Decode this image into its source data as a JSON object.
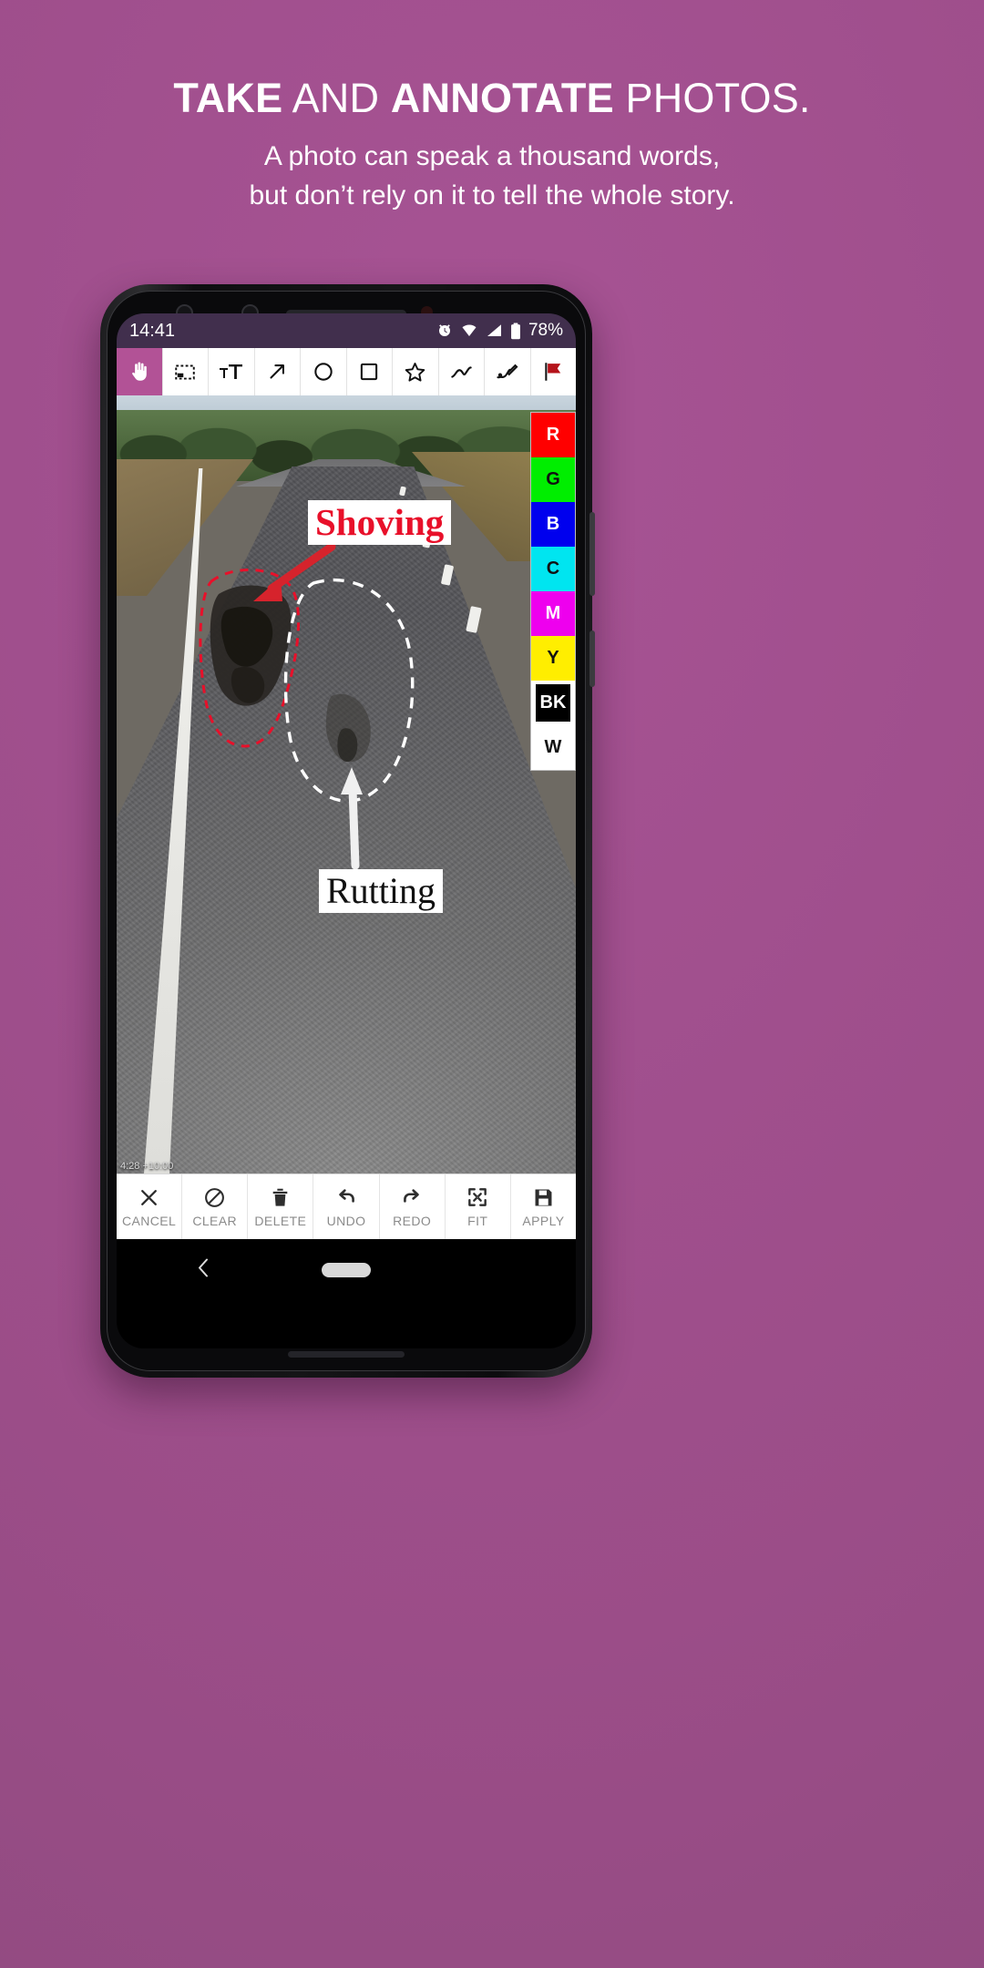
{
  "promo": {
    "headline_part1": "TAKE",
    "headline_part2": " AND ",
    "headline_part3": "ANNOTATE",
    "headline_part4": " PHOTOS.",
    "subtitle_line1": "A photo can speak a thousand words,",
    "subtitle_line2": "but don’t rely on it to tell the whole story.",
    "background_color": "#a04f8d",
    "text_color": "#ffffff"
  },
  "phone": {
    "statusbar": {
      "time": "14:41",
      "battery_percent": "78%",
      "icons": [
        "alarm-icon",
        "wifi-icon",
        "signal-icon",
        "battery-icon"
      ],
      "background_color": "#412f4d"
    },
    "navbar": {
      "back_label": "back-button",
      "home_pill": "home-pill"
    }
  },
  "toolbar": {
    "active_index": 0,
    "tools": [
      {
        "name": "pan-tool",
        "label": "Pan"
      },
      {
        "name": "crop-tool",
        "label": "Crop"
      },
      {
        "name": "text-tool",
        "label": "Text"
      },
      {
        "name": "arrow-tool",
        "label": "Arrow"
      },
      {
        "name": "ellipse-tool",
        "label": "Ellipse"
      },
      {
        "name": "rectangle-tool",
        "label": "Rectangle"
      },
      {
        "name": "star-tool",
        "label": "Star"
      },
      {
        "name": "polyline-tool",
        "label": "Polyline"
      },
      {
        "name": "freehand-tool",
        "label": "Freehand"
      },
      {
        "name": "flag-tool",
        "label": "Flag"
      }
    ]
  },
  "palette": {
    "swatches": [
      {
        "label": "R",
        "color": "#ff0000",
        "text_color": "#ffffff",
        "name": "color-red"
      },
      {
        "label": "G",
        "color": "#00ee00",
        "text_color": "#111111",
        "name": "color-green"
      },
      {
        "label": "B",
        "color": "#0000ee",
        "text_color": "#ffffff",
        "name": "color-blue"
      },
      {
        "label": "C",
        "color": "#00e5f0",
        "text_color": "#111111",
        "name": "color-cyan"
      },
      {
        "label": "M",
        "color": "#ee00ee",
        "text_color": "#ffffff",
        "name": "color-magenta"
      },
      {
        "label": "Y",
        "color": "#ffee00",
        "text_color": "#111111",
        "name": "color-yellow"
      },
      {
        "label": "BK",
        "color": "#000000",
        "text_color": "#ffffff",
        "name": "color-black"
      },
      {
        "label": "W",
        "color": "#ffffff",
        "text_color": "#111111",
        "name": "color-white"
      }
    ]
  },
  "canvas": {
    "photo_description": "road-surface-photo",
    "photo_timestamp": "4:28 +10:00",
    "annotations": [
      {
        "name": "annotation-label-shoving",
        "text": "Shoving",
        "color": "#e8102a"
      },
      {
        "name": "annotation-label-rutting",
        "text": "Rutting",
        "color": "#111111"
      }
    ]
  },
  "actionbar": {
    "actions": [
      {
        "name": "cancel-button",
        "label": "CANCEL",
        "icon": "close-icon"
      },
      {
        "name": "clear-button",
        "label": "CLEAR",
        "icon": "no-entry-icon"
      },
      {
        "name": "delete-button",
        "label": "DELETE",
        "icon": "trash-icon"
      },
      {
        "name": "undo-button",
        "label": "UNDO",
        "icon": "undo-icon"
      },
      {
        "name": "redo-button",
        "label": "REDO",
        "icon": "redo-icon"
      },
      {
        "name": "fit-button",
        "label": "FIT",
        "icon": "fit-screen-icon"
      },
      {
        "name": "apply-button",
        "label": "APPLY",
        "icon": "save-icon"
      }
    ]
  }
}
